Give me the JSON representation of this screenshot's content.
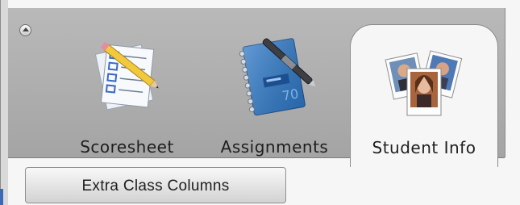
{
  "toolbar": {
    "collapse_icon": "collapse-triangle-icon",
    "tabs": [
      {
        "label": "Scoresheet",
        "icon": "scoresheet-papers-icon",
        "selected": false
      },
      {
        "label": "Assignments",
        "icon": "notebook-pen-icon",
        "selected": false
      },
      {
        "label": "Student Info",
        "icon": "student-photos-icon",
        "selected": true
      }
    ]
  },
  "content": {
    "extra_columns_label": "Extra Class Columns"
  },
  "colors": {
    "toolbar_bg": "#aeaeae",
    "selected_tab_bg": "#f6f6f6",
    "accent_blue": "#3c69b5"
  }
}
